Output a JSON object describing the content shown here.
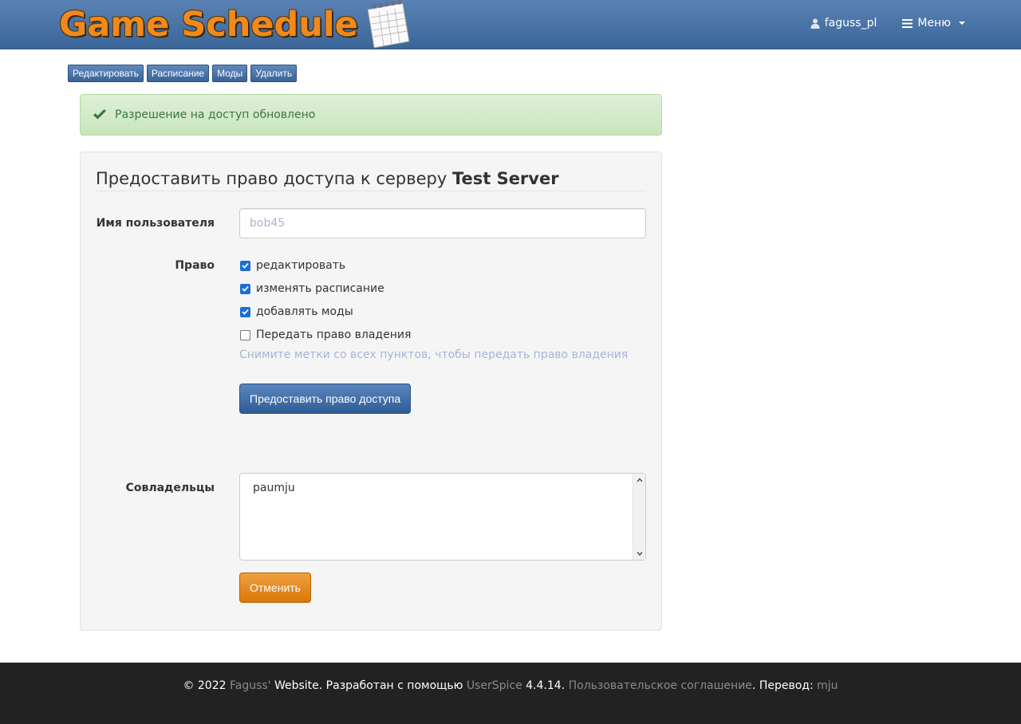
{
  "header": {
    "logo_text": "Game Schedule",
    "user": "faguss_pl",
    "menu": "Меню"
  },
  "toolbar": {
    "edit": "Редактировать",
    "schedule": "Расписание",
    "mods": "Моды",
    "delete": "Удалить"
  },
  "alert": {
    "text": "Разрешение на доступ обновлено"
  },
  "form": {
    "title_prefix": "Предоставить право доступа к серверу ",
    "server_name": "Test Server",
    "username_label": "Имя пользователя",
    "username_placeholder": "bob45",
    "permission_label": "Право",
    "permissions": [
      {
        "label": "редактировать",
        "checked": true
      },
      {
        "label": "изменять расписание",
        "checked": true
      },
      {
        "label": "добавлять моды",
        "checked": true
      },
      {
        "label": "Передать право владения",
        "checked": false
      }
    ],
    "help_text": "Снимите метки со всех пунктов, чтобы передать право владения",
    "submit": "Предоставить право доступа",
    "coowners_label": "Совладельцы",
    "coowners": "paumju",
    "cancel": "Отменить"
  },
  "footer": {
    "copyright": "© 2022 ",
    "site_link": "Faguss'",
    "site_rest": " Website. Разработан с помощью ",
    "userspice_link": "UserSpice",
    "version": " 4.4.14. ",
    "terms_link": "Пользовательское соглашение",
    "translation": ". Перевод: ",
    "translator_link": "mju"
  },
  "colors": {
    "navbar": "#3b6699",
    "alert_bg": "#dff0d8",
    "alert_text": "#3c763d",
    "primary": "#2f5d95",
    "warning": "#d97707",
    "footer_bg": "#222222"
  }
}
